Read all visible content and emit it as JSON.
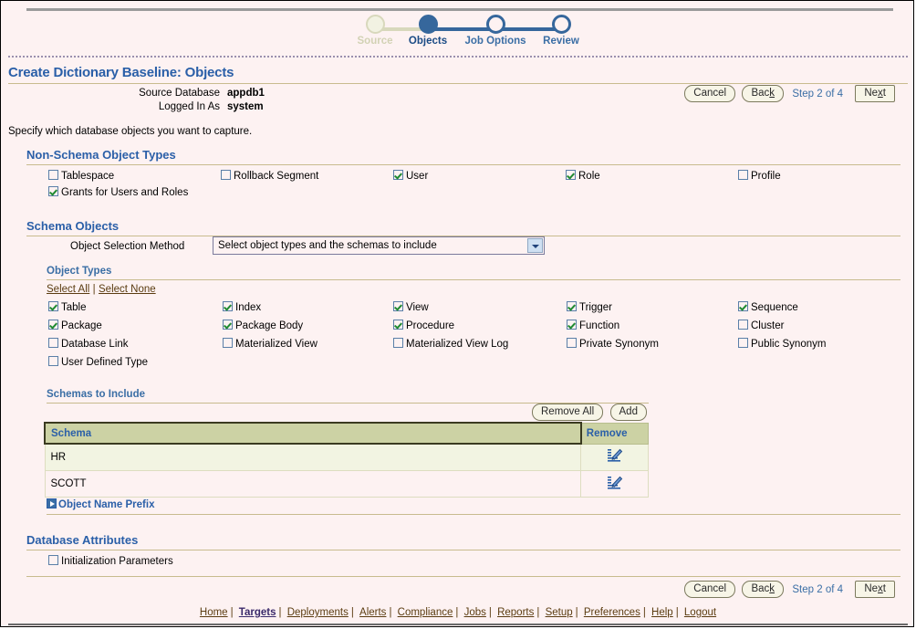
{
  "train": {
    "steps": [
      {
        "label": "Source",
        "state": "done"
      },
      {
        "label": "Objects",
        "state": "current"
      },
      {
        "label": "Job Options",
        "state": "future"
      },
      {
        "label": "Review",
        "state": "future"
      }
    ]
  },
  "header": {
    "title": "Create Dictionary Baseline: Objects",
    "source_database_label": "Source Database",
    "source_database_value": "appdb1",
    "logged_in_as_label": "Logged In As",
    "logged_in_as_value": "system",
    "cancel_label": "Cancel",
    "back_label": "Back",
    "back_accel": "k",
    "step_text": "Step 2 of 4",
    "next_label": "Next",
    "next_accel": "x"
  },
  "instruction": "Specify which database objects you want to capture.",
  "non_schema": {
    "heading": "Non-Schema Object Types",
    "items": [
      {
        "label": "Tablespace",
        "checked": false
      },
      {
        "label": "Rollback Segment",
        "checked": false
      },
      {
        "label": "User",
        "checked": true
      },
      {
        "label": "Role",
        "checked": true
      },
      {
        "label": "Profile",
        "checked": false
      },
      {
        "label": "Grants for Users and Roles",
        "checked": true
      }
    ]
  },
  "schema_objects": {
    "heading": "Schema Objects",
    "selection_method_label": "Object Selection Method",
    "selection_method_value": "Select object types and the schemas to include",
    "object_types_label": "Object Types",
    "select_all_label": "Select All",
    "select_none_label": "Select None",
    "types": [
      {
        "label": "Table",
        "checked": true
      },
      {
        "label": "Index",
        "checked": true
      },
      {
        "label": "View",
        "checked": true
      },
      {
        "label": "Trigger",
        "checked": true
      },
      {
        "label": "Sequence",
        "checked": true
      },
      {
        "label": "Package",
        "checked": true
      },
      {
        "label": "Package Body",
        "checked": true
      },
      {
        "label": "Procedure",
        "checked": true
      },
      {
        "label": "Function",
        "checked": true
      },
      {
        "label": "Cluster",
        "checked": false
      },
      {
        "label": "Database Link",
        "checked": false
      },
      {
        "label": "Materialized View",
        "checked": false
      },
      {
        "label": "Materialized View Log",
        "checked": false
      },
      {
        "label": "Private Synonym",
        "checked": false
      },
      {
        "label": "Public Synonym",
        "checked": false
      },
      {
        "label": "User Defined Type",
        "checked": false
      }
    ],
    "schemas_to_include_label": "Schemas to Include",
    "remove_all_label": "Remove All",
    "add_label": "Add",
    "table": {
      "columns": [
        "Schema",
        "Remove"
      ],
      "rows": [
        {
          "schema": "HR",
          "remove_icon": "edit-icon"
        },
        {
          "schema": "SCOTT",
          "remove_icon": "edit-icon"
        }
      ]
    },
    "object_name_prefix_label": "Object Name Prefix"
  },
  "database_attributes": {
    "heading": "Database Attributes",
    "items": [
      {
        "label": "Initialization Parameters",
        "checked": false
      }
    ]
  },
  "footer_buttons": {
    "cancel_label": "Cancel",
    "back_label": "Back",
    "back_accel": "k",
    "step_text": "Step 2 of 4",
    "next_label": "Next",
    "next_accel": "x"
  },
  "footer_nav": {
    "items": [
      {
        "label": "Home",
        "active": false
      },
      {
        "label": "Targets",
        "active": true
      },
      {
        "label": "Deployments",
        "active": false
      },
      {
        "label": "Alerts",
        "active": false
      },
      {
        "label": "Compliance",
        "active": false
      },
      {
        "label": "Jobs",
        "active": false
      },
      {
        "label": "Reports",
        "active": false
      },
      {
        "label": "Setup",
        "active": false
      },
      {
        "label": "Preferences",
        "active": false
      },
      {
        "label": "Help",
        "active": false
      },
      {
        "label": "Logout",
        "active": false
      }
    ],
    "separator": "|"
  },
  "colors": {
    "page_background": "#fdf2f2",
    "accent_blue": "#2a5fa8",
    "train_blue": "#36679c",
    "rule_khaki": "#c8bb8e",
    "table_header": "#ccd2a4",
    "link_brown": "#5b3c11",
    "check_green": "#1f8a32"
  }
}
